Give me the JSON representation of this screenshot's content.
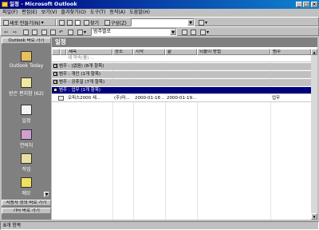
{
  "window": {
    "title": "일정 - Microsoft Outlook"
  },
  "menu": [
    "파일(F)",
    "편집(E)",
    "보기(V)",
    "즐겨찾기(O)",
    "도구(T)",
    "동작(A)",
    "도움말(H)"
  ],
  "toolbar1": {
    "new_label": "새로 만들기(N)",
    "find_label": "찾기",
    "organize_label": "구성(Z)"
  },
  "toolbar2": {
    "view_select": "범주별로"
  },
  "outlook_bar": {
    "header": "Outlook 바로 가기",
    "items": [
      "Outlook Today",
      "받은 편지함 (62)",
      "일정",
      "연락처",
      "작업",
      "메모"
    ],
    "footer1": "사용자 정의 바로 가기",
    "footer2": "기타 바로 가기"
  },
  "folder": {
    "title": "일정"
  },
  "columns": {
    "subject": "제목",
    "location": "장소",
    "start": "시작",
    "end": "끝",
    "recurrence": "되풀이 방법",
    "categories": "범주"
  },
  "new_item_prompt": "새 약속(를) ...",
  "groups": [
    "범주 : (없음) (8개 항목)",
    "범주 : 개인 (1개 항목)",
    "범주 : 공휴일 (7개 항목)",
    "범주 : 업무 (1개 항목)"
  ],
  "item": {
    "subject": "오피스2000 새...",
    "location": "(주)마...",
    "start": "2000-01-18 ...",
    "end": "2000-01-19...",
    "category": "업무"
  },
  "status": "8개 항목",
  "colors": {
    "title_start": "#000080",
    "title_end": "#1084d0",
    "selection": "#000080",
    "bar_bg": "#808080"
  }
}
